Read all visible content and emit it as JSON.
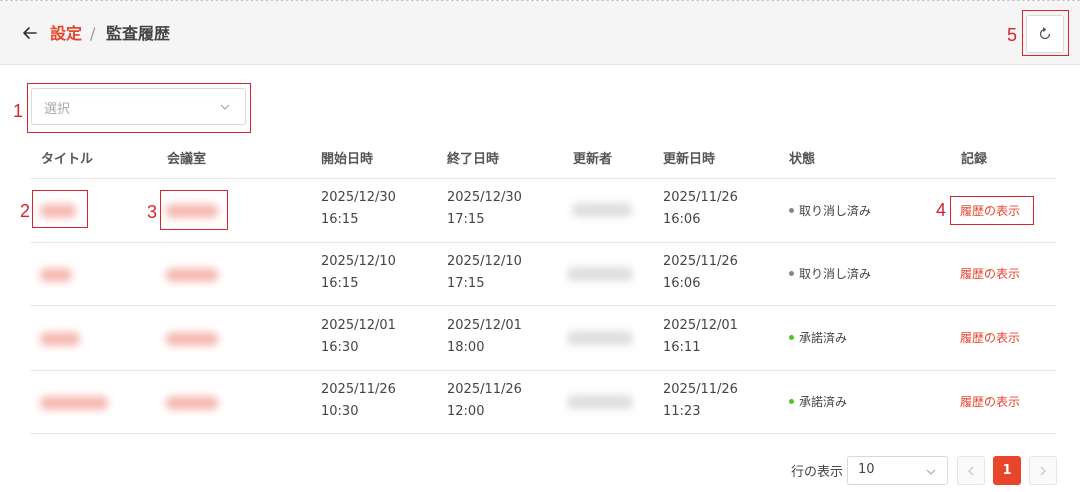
{
  "header": {
    "parent": "設定",
    "separator": "/",
    "current": "監査履歴"
  },
  "filter": {
    "placeholder": "選択"
  },
  "table": {
    "columns": [
      "タイトル",
      "会議室",
      "開始日時",
      "終了日時",
      "更新者",
      "更新日時",
      "状態",
      "記録"
    ],
    "rows": [
      {
        "start_date": "2025/12/30",
        "start_time": "16:15",
        "end_date": "2025/12/30",
        "end_time": "17:15",
        "updated_date": "2025/11/26",
        "updated_time": "16:06",
        "status": "取り消し済み",
        "status_color": "#888888",
        "link": "履歴の表示"
      },
      {
        "start_date": "2025/12/10",
        "start_time": "16:15",
        "end_date": "2025/12/10",
        "end_time": "17:15",
        "updated_date": "2025/11/26",
        "updated_time": "16:06",
        "status": "取り消し済み",
        "status_color": "#888888",
        "link": "履歴の表示"
      },
      {
        "start_date": "2025/12/01",
        "start_time": "16:30",
        "end_date": "2025/12/01",
        "end_time": "18:00",
        "updated_date": "2025/12/01",
        "updated_time": "16:11",
        "status": "承諾済み",
        "status_color": "#52c41a",
        "link": "履歴の表示"
      },
      {
        "start_date": "2025/11/26",
        "start_time": "10:30",
        "end_date": "2025/11/26",
        "end_time": "12:00",
        "updated_date": "2025/11/26",
        "updated_time": "11:23",
        "status": "承諾済み",
        "status_color": "#52c41a",
        "link": "履歴の表示"
      }
    ]
  },
  "pagination": {
    "rows_label": "行の表示",
    "page_size": "10",
    "current_page": "1"
  },
  "annotations": [
    "1",
    "2",
    "3",
    "4",
    "5"
  ],
  "colors": {
    "accent": "#e8452b",
    "annotation": "#d9232d"
  }
}
